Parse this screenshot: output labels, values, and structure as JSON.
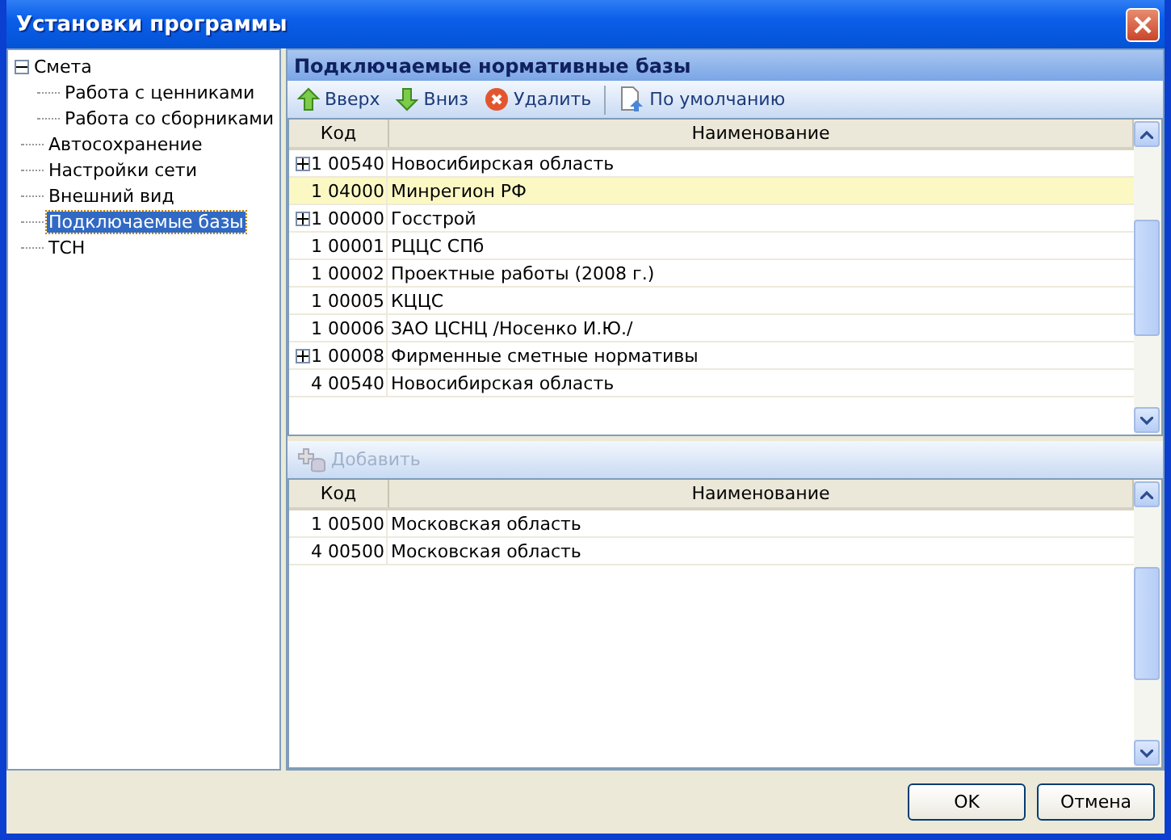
{
  "window": {
    "title": "Установки программы"
  },
  "tree": [
    {
      "label": "Смета",
      "expanded": true,
      "selected": false,
      "children": [
        {
          "label": "Работа с ценниками",
          "selected": false
        },
        {
          "label": "Работа со сборниками",
          "selected": false
        }
      ]
    },
    {
      "label": "Автосохранение",
      "selected": false
    },
    {
      "label": "Настройки сети",
      "selected": false
    },
    {
      "label": "Внешний вид",
      "selected": false
    },
    {
      "label": "Подключаемые базы",
      "selected": true
    },
    {
      "label": "ТСН",
      "selected": false
    }
  ],
  "panel_title": "Подключаемые нормативные базы",
  "toolbar": [
    {
      "kind": "up",
      "label": "Вверх",
      "disabled": false
    },
    {
      "kind": "down",
      "label": "Вниз",
      "disabled": false
    },
    {
      "kind": "delete",
      "label": "Удалить",
      "disabled": false
    },
    {
      "kind": "default",
      "label": "По умолчанию",
      "disabled": false
    }
  ],
  "bases_table": {
    "columns": [
      "Код",
      "Наименование"
    ],
    "rows": [
      {
        "code": "1 00540",
        "name": "Новосибирская область",
        "expandable": true,
        "selected": false
      },
      {
        "code": "1 04000",
        "name": "Минрегион РФ",
        "expandable": false,
        "selected": true
      },
      {
        "code": "1 00000",
        "name": "Госстрой",
        "expandable": true,
        "selected": false
      },
      {
        "code": "1 00001",
        "name": "РЦЦС СПб",
        "expandable": false,
        "selected": false
      },
      {
        "code": "1 00002",
        "name": "Проектные работы (2008 г.)",
        "expandable": false,
        "selected": false
      },
      {
        "code": "1 00005",
        "name": "КЦЦС",
        "expandable": false,
        "selected": false
      },
      {
        "code": "1 00006",
        "name": "ЗАО ЦСНЦ /Носенко И.Ю./",
        "expandable": false,
        "selected": false
      },
      {
        "code": "1 00008",
        "name": "Фирменные сметные нормативы",
        "expandable": true,
        "selected": false
      },
      {
        "code": "4 00540",
        "name": "Новосибирская область",
        "expandable": false,
        "selected": false
      }
    ]
  },
  "add_toolbar": [
    {
      "kind": "add",
      "label": "Добавить",
      "disabled": true
    }
  ],
  "connected_table": {
    "columns": [
      "Код",
      "Наименование"
    ],
    "rows": [
      {
        "code": "1 00500",
        "name": "Московская область",
        "expandable": false,
        "selected": false
      },
      {
        "code": "4 00500",
        "name": "Московская область",
        "expandable": false,
        "selected": false
      }
    ]
  },
  "buttons": [
    "OK",
    "Отмена"
  ]
}
